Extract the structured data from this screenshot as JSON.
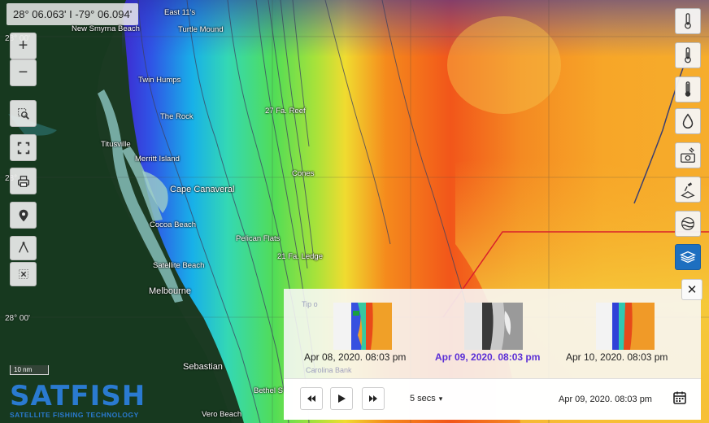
{
  "coordinates": "28° 06.063' I -79° 06.094'",
  "lat_labels": {
    "top": "28° 00'",
    "mid": "28°",
    "bottom": "28° 00'"
  },
  "places": {
    "east11s": "East 11's",
    "new_smyrna": "New Smyrna Beach",
    "turtle_mound": "Turtle Mound",
    "twin_humps": "Twin Humps",
    "the_rock": "The Rock",
    "reef27": "27 Fa. Reef",
    "titusville": "Titusville",
    "merritt": "Merritt Island",
    "cones": "Cones",
    "cape_canaveral": "Cape Canaveral",
    "cocoa_beach": "Cocoa Beach",
    "pelican_flats": "Pelican Flats",
    "ledge21": "21 Fa. Ledge",
    "satellite_beach": "Satellite Beach",
    "melbourne": "Melbourne",
    "sebastian": "Sebastian",
    "bethel": "Bethel S",
    "vero": "Vero Beach",
    "tip": "Tip o",
    "bank": "Carolina Bank"
  },
  "scale": "10 nm",
  "logo": {
    "word_a": "SAT",
    "word_b": "FISH",
    "tagline": "SATELLITE FISHING TECHNOLOGY"
  },
  "map_controls": [
    {
      "name": "zoom-in-button",
      "glyph": "+"
    },
    {
      "name": "zoom-out-button",
      "glyph": "−"
    }
  ],
  "right_tools": [
    {
      "name": "sst-low-thermometer-icon"
    },
    {
      "name": "sst-mid-thermometer-icon"
    },
    {
      "name": "sst-high-thermometer-icon"
    },
    {
      "name": "chlorophyll-drop-icon"
    },
    {
      "name": "satellite-photo-icon"
    },
    {
      "name": "satellite-altimetry-icon"
    },
    {
      "name": "currents-wind-icon"
    },
    {
      "name": "layers-stack-icon"
    }
  ],
  "animation": {
    "frames": [
      {
        "label": "Apr 08, 2020. 08:03 pm",
        "type": "sst"
      },
      {
        "label": "Apr 09, 2020. 08:03 pm",
        "type": "gray"
      },
      {
        "label": "Apr 10, 2020. 08:03 pm",
        "type": "sst"
      }
    ],
    "interval": "5 secs",
    "current_time": "Apr 09, 2020. 08:03 pm",
    "close_glyph": "✕"
  },
  "colors": {
    "active_frame": "#5b2fd6",
    "active_tool": "#1d6fc0"
  }
}
